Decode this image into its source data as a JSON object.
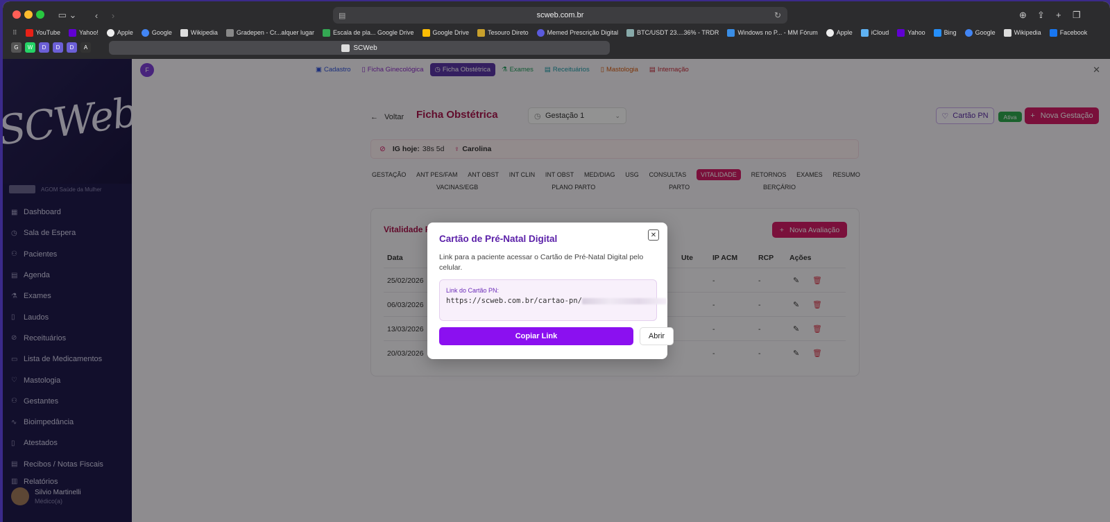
{
  "browser": {
    "url": "scweb.com.br",
    "tab_title": "SCWeb",
    "bookmarks": [
      "YouTube",
      "Yahoo!",
      "Apple",
      "Google",
      "Wikipedia",
      "Gradepen - Cr...alquer lugar",
      "Escala de pla... Google Drive",
      "Google Drive",
      "Tesouro Direto",
      "Memed Prescrição Digital",
      "BTC/USDT 23....36% - TRDR",
      "Windows no P... - MM Fórum",
      "Apple",
      "iCloud",
      "Yahoo",
      "Bing",
      "Google",
      "Wikipedia",
      "Facebook"
    ],
    "pinned": [
      "G",
      "W",
      "D",
      "D",
      "D",
      "A"
    ]
  },
  "sidebar": {
    "logo": "SCWeb",
    "clinic": "AGOM Saúde da Mulher",
    "items": [
      {
        "label": "Dashboard",
        "icon": "grid-icon"
      },
      {
        "label": "Sala de Espera",
        "icon": "clock-icon"
      },
      {
        "label": "Pacientes",
        "icon": "users-icon"
      },
      {
        "label": "Agenda",
        "icon": "calendar-icon"
      },
      {
        "label": "Exames",
        "icon": "flask-icon"
      },
      {
        "label": "Laudos",
        "icon": "document-icon"
      },
      {
        "label": "Receituários",
        "icon": "pill-icon"
      },
      {
        "label": "Lista de Medicamentos",
        "icon": "book-icon"
      },
      {
        "label": "Mastologia",
        "icon": "ribbon-icon"
      },
      {
        "label": "Gestantes",
        "icon": "users-icon"
      },
      {
        "label": "Bioimpedância",
        "icon": "activity-icon"
      },
      {
        "label": "Atestados",
        "icon": "document-icon"
      },
      {
        "label": "Recibos / Notas Fiscais",
        "icon": "receipt-icon"
      },
      {
        "label": "Relatórios",
        "icon": "chart-icon"
      }
    ],
    "user": {
      "name": "Silvio Martinelli",
      "role": "Médico(a)"
    }
  },
  "topnav": {
    "avatar": "F",
    "items": [
      {
        "label": "Cadastro",
        "color": "#2d4fd6"
      },
      {
        "label": "Ficha Ginecológica",
        "color": "#8a2bc4"
      },
      {
        "label": "Ficha Obstétrica",
        "color": "#ffffff",
        "active": true
      },
      {
        "label": "Exames",
        "color": "#1f9a5b"
      },
      {
        "label": "Receituários",
        "color": "#1c9aa5"
      },
      {
        "label": "Mastologia",
        "color": "#d55a0e"
      },
      {
        "label": "Internação",
        "color": "#c42b3a"
      }
    ]
  },
  "header": {
    "back": "Voltar",
    "title": "Ficha Obstétrica",
    "gestacao": "Gestação 1",
    "cartao_btn": "Cartão PN",
    "status": "Ativa",
    "nova_btn": "Nova Gestação"
  },
  "ig": {
    "label": "IG hoje:",
    "value": "38s 5d",
    "patient": "Carolina"
  },
  "sections": {
    "row1": [
      "GESTAÇÃO",
      "ANT PES/FAM",
      "ANT OBST",
      "INT CLIN",
      "INT OBST",
      "MED/DIAG",
      "USG",
      "CONSULTAS",
      "VITALIDADE",
      "RETORNOS",
      "EXAMES",
      "RESUMO"
    ],
    "row2": [
      "VACINAS/EGB",
      "PLANO PARTO",
      "PARTO",
      "BERÇÁRIO"
    ],
    "active": "VITALIDADE"
  },
  "vitalidade": {
    "title": "Vitalidade F",
    "nova_btn": "Nova Avaliação",
    "columns": [
      "Data",
      "Ute",
      "IP ACM",
      "RCP",
      "Ações"
    ],
    "rows": [
      {
        "data": "25/02/2026",
        "ipacm": "-",
        "rcp": "-"
      },
      {
        "data": "06/03/2026",
        "ipacm": "-",
        "rcp": "-"
      },
      {
        "data": "13/03/2026",
        "ipacm": "-",
        "rcp": "-"
      },
      {
        "data": "20/03/2026",
        "ipacm": "-",
        "rcp": "-"
      }
    ]
  },
  "modal": {
    "title": "Cartão de Pré-Natal Digital",
    "description": "Link para a paciente acessar o Cartão de Pré-Natal Digital pelo celular.",
    "link_label": "Link do Cartão PN:",
    "link_value": "https://scweb.com.br/cartao-pn/",
    "copy_btn": "Copiar Link",
    "open_btn": "Abrir",
    "close_icon": "close-icon"
  }
}
